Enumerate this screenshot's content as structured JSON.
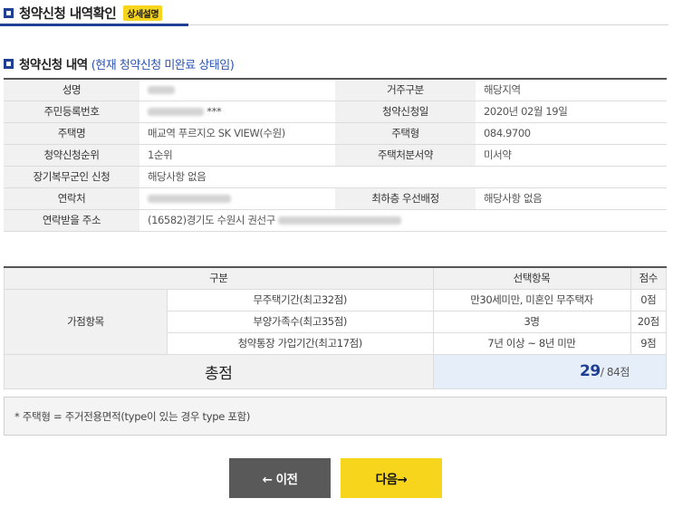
{
  "page": {
    "title": "청약신청 내역확인",
    "badge": "상세설명"
  },
  "section": {
    "title": "청약신청 내역",
    "subtitle": "(현재 청약신청 미완료 상태임)"
  },
  "info": {
    "name_label": "성명",
    "residence_label": "거주구분",
    "residence_value": "해당지역",
    "rrn_label": "주민등록번호",
    "rrn_suffix": "***",
    "apply_date_label": "청약신청일",
    "apply_date_value": "2020년 02월 19일",
    "house_name_label": "주택명",
    "house_name_value": "매교역 푸르지오 SK VIEW(수원)",
    "house_type_label": "주택형",
    "house_type_value": "084.9700",
    "rank_label": "청약신청순위",
    "rank_value": "1순위",
    "disposal_label": "주택처분서약",
    "disposal_value": "미서약",
    "military_label": "장기복무군인 신청",
    "military_value": "해당사항 없음",
    "contact_label": "연락처",
    "top_floor_label": "최하층 우선배정",
    "top_floor_value": "해당사항 없음",
    "address_label": "연락받을 주소",
    "address_value": "(16582)경기도 수원시 권선구"
  },
  "score": {
    "headers": [
      "구분",
      "선택항목",
      "점수"
    ],
    "group_label": "가점항목",
    "rows": [
      {
        "item": "무주택기간(최고32점)",
        "choice": "만30세미만, 미혼인 무주택자",
        "points": "0점"
      },
      {
        "item": "부양가족수(최고35점)",
        "choice": "3명",
        "points": "20점"
      },
      {
        "item": "청약통장 가입기간(최고17점)",
        "choice": "7년 이상 ~ 8년 미만",
        "points": "9점"
      }
    ],
    "total_label": "총점",
    "total_value": "29",
    "total_max": "/ 84점"
  },
  "note": "* 주택형 = 주거전용면적(type이 있는 경우 type 포함)",
  "buttons": {
    "prev": "← 이전",
    "next": "다음→"
  }
}
